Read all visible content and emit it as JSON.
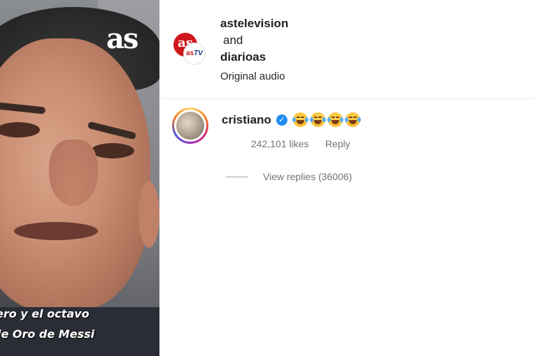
{
  "video": {
    "logo": "as",
    "caption_line1": "ero y el octavo",
    "caption_line2": "de Oro de Messi"
  },
  "audio_info": {
    "account1": "astelevision",
    "joiner": "and",
    "account2": "diarioas",
    "audio_label": "Original audio",
    "avatar_text_red": "as",
    "avatar_text_small_1": "as",
    "avatar_text_small_2": "TV"
  },
  "comment": {
    "username": "cristiano",
    "verified": true,
    "emoji_text": "😂😂😂😂",
    "likes": "242,101 likes",
    "reply_label": "Reply",
    "view_replies": "View replies (36006)"
  },
  "colors": {
    "text_primary": "#1f1f1f",
    "text_secondary": "#737373",
    "verified_blue": "#1f8ef1",
    "as_red": "#d0171e"
  }
}
